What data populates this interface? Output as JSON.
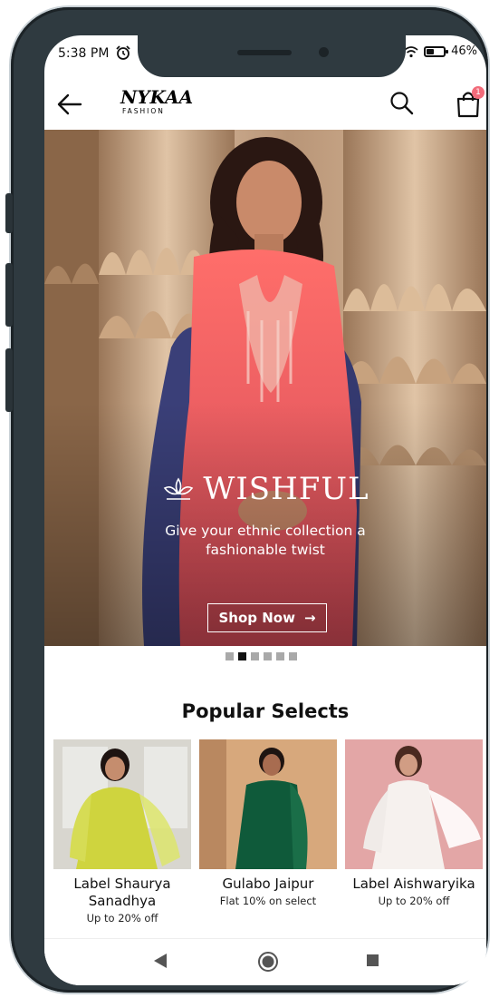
{
  "status_bar": {
    "time": "5:38 PM",
    "battery": "46%",
    "battery_level": 0.46
  },
  "app_bar": {
    "logo_main": "NYKAA",
    "logo_sub": "FASHION",
    "cart_count": "1"
  },
  "banner": {
    "brand": "WISHFUL",
    "tagline_line1": "Give your ethnic collection a",
    "tagline_line2": "fashionable twist",
    "cta": "Shop Now",
    "cta_arrow": "→",
    "slide_count": 6,
    "active_slide": 2
  },
  "popular": {
    "title": "Popular Selects",
    "items": [
      {
        "name": "Label Shaurya Sanadhya",
        "offer": "Up to 20% off"
      },
      {
        "name": "Gulabo Jaipur",
        "offer": "Flat 10% on select"
      },
      {
        "name": "Label Aishwaryika",
        "offer": "Up to 20% off"
      }
    ]
  },
  "colors": {
    "accent_badge": "#f26b7a",
    "phone_frame": "#2f3a40"
  }
}
